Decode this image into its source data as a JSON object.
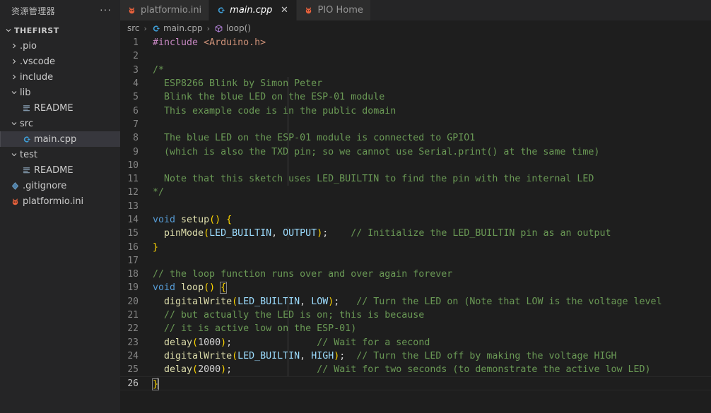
{
  "sidebar": {
    "title": "资源管理器",
    "more_label": "···",
    "root": {
      "label": "THEFIRST",
      "expanded": true
    },
    "items": [
      {
        "label": ".pio",
        "type": "folder",
        "expanded": false,
        "indent": 1,
        "icon": "chevron-right-icon"
      },
      {
        "label": ".vscode",
        "type": "folder",
        "expanded": false,
        "indent": 1,
        "icon": "chevron-right-icon"
      },
      {
        "label": "include",
        "type": "folder",
        "expanded": false,
        "indent": 1,
        "icon": "chevron-right-icon"
      },
      {
        "label": "lib",
        "type": "folder",
        "expanded": true,
        "indent": 1,
        "icon": "chevron-down-icon"
      },
      {
        "label": "README",
        "type": "file",
        "indent": 2,
        "icon": "readme-icon"
      },
      {
        "label": "src",
        "type": "folder",
        "expanded": true,
        "indent": 1,
        "icon": "chevron-down-icon"
      },
      {
        "label": "main.cpp",
        "type": "file",
        "indent": 2,
        "icon": "cpp-file-icon",
        "selected": true
      },
      {
        "label": "test",
        "type": "folder",
        "expanded": true,
        "indent": 1,
        "icon": "chevron-down-icon"
      },
      {
        "label": "README",
        "type": "file",
        "indent": 2,
        "icon": "readme-icon"
      },
      {
        "label": ".gitignore",
        "type": "file",
        "indent": 1,
        "icon": "git-icon"
      },
      {
        "label": "platformio.ini",
        "type": "file",
        "indent": 1,
        "icon": "platformio-icon"
      }
    ]
  },
  "tabs": [
    {
      "label": "platformio.ini",
      "icon": "platformio-icon",
      "active": false,
      "closable": false
    },
    {
      "label": "main.cpp",
      "icon": "cpp-file-icon",
      "active": true,
      "closable": true,
      "close_label": "✕"
    },
    {
      "label": "PIO Home",
      "icon": "platformio-icon",
      "active": false,
      "closable": false
    }
  ],
  "breadcrumb": {
    "separator": "›",
    "items": [
      {
        "label": "src",
        "icon": null
      },
      {
        "label": "main.cpp",
        "icon": "cpp-file-icon"
      },
      {
        "label": "loop()",
        "icon": "symbol-method-icon"
      }
    ]
  },
  "editor": {
    "language": "cpp",
    "active_line": 26,
    "total_lines": 26,
    "lines": [
      {
        "n": 1,
        "tokens": [
          {
            "t": "#include ",
            "c": "t-pp"
          },
          {
            "t": "<Arduino.h>",
            "c": "t-str"
          }
        ]
      },
      {
        "n": 2,
        "tokens": []
      },
      {
        "n": 3,
        "tokens": [
          {
            "t": "/*",
            "c": "t-cmt"
          }
        ]
      },
      {
        "n": 4,
        "tokens": [
          {
            "t": "  ESP8266 Blink by Simon Peter",
            "c": "t-cmt"
          }
        ]
      },
      {
        "n": 5,
        "tokens": [
          {
            "t": "  Blink the blue LED on the ESP-01 module",
            "c": "t-cmt"
          }
        ]
      },
      {
        "n": 6,
        "tokens": [
          {
            "t": "  This example code is in the public domain",
            "c": "t-cmt"
          }
        ]
      },
      {
        "n": 7,
        "tokens": []
      },
      {
        "n": 8,
        "tokens": [
          {
            "t": "  The blue LED on the ESP-01 module is connected to GPIO1",
            "c": "t-cmt"
          }
        ]
      },
      {
        "n": 9,
        "tokens": [
          {
            "t": "  (which is also the TXD pin; so we cannot use Serial.print() at the same time)",
            "c": "t-cmt"
          }
        ]
      },
      {
        "n": 10,
        "tokens": []
      },
      {
        "n": 11,
        "tokens": [
          {
            "t": "  Note that this sketch uses LED_BUILTIN to find the pin with the internal LED",
            "c": "t-cmt"
          }
        ]
      },
      {
        "n": 12,
        "tokens": [
          {
            "t": "*/",
            "c": "t-cmt"
          }
        ]
      },
      {
        "n": 13,
        "tokens": []
      },
      {
        "n": 14,
        "tokens": [
          {
            "t": "void",
            "c": "t-kw"
          },
          {
            "t": " ",
            "c": "t-punc"
          },
          {
            "t": "setup",
            "c": "t-fn"
          },
          {
            "t": "()",
            "c": "t-br1"
          },
          {
            "t": " ",
            "c": "t-punc"
          },
          {
            "t": "{",
            "c": "t-br1"
          }
        ]
      },
      {
        "n": 15,
        "tokens": [
          {
            "t": "  ",
            "c": "t-punc"
          },
          {
            "t": "pinMode",
            "c": "t-fn"
          },
          {
            "t": "(",
            "c": "t-br1"
          },
          {
            "t": "LED_BUILTIN",
            "c": "t-var"
          },
          {
            "t": ", ",
            "c": "t-punc"
          },
          {
            "t": "OUTPUT",
            "c": "t-var"
          },
          {
            "t": ")",
            "c": "t-br1"
          },
          {
            "t": ";",
            "c": "t-punc"
          },
          {
            "t": "    ",
            "c": "t-punc"
          },
          {
            "t": "// Initialize the LED_BUILTIN pin as an output",
            "c": "t-cmt"
          }
        ]
      },
      {
        "n": 16,
        "tokens": [
          {
            "t": "}",
            "c": "t-br1"
          }
        ]
      },
      {
        "n": 17,
        "tokens": []
      },
      {
        "n": 18,
        "tokens": [
          {
            "t": "// the loop function runs over and over again forever",
            "c": "t-cmt"
          }
        ]
      },
      {
        "n": 19,
        "tokens": [
          {
            "t": "void",
            "c": "t-kw"
          },
          {
            "t": " ",
            "c": "t-punc"
          },
          {
            "t": "loop",
            "c": "t-fn"
          },
          {
            "t": "()",
            "c": "t-br1"
          },
          {
            "t": " ",
            "c": "t-punc"
          },
          {
            "t": "{",
            "c": "t-br1 brmatch"
          }
        ]
      },
      {
        "n": 20,
        "tokens": [
          {
            "t": "  ",
            "c": "t-punc"
          },
          {
            "t": "digitalWrite",
            "c": "t-fn"
          },
          {
            "t": "(",
            "c": "t-br1"
          },
          {
            "t": "LED_BUILTIN",
            "c": "t-var"
          },
          {
            "t": ", ",
            "c": "t-punc"
          },
          {
            "t": "LOW",
            "c": "t-var"
          },
          {
            "t": ")",
            "c": "t-br1"
          },
          {
            "t": ";",
            "c": "t-punc"
          },
          {
            "t": "   ",
            "c": "t-punc"
          },
          {
            "t": "// Turn the LED on (Note that LOW is the voltage level",
            "c": "t-cmt"
          }
        ]
      },
      {
        "n": 21,
        "tokens": [
          {
            "t": "  // but actually the LED is on; this is because",
            "c": "t-cmt"
          }
        ]
      },
      {
        "n": 22,
        "tokens": [
          {
            "t": "  // it is active low on the ESP-01)",
            "c": "t-cmt"
          }
        ]
      },
      {
        "n": 23,
        "tokens": [
          {
            "t": "  ",
            "c": "t-punc"
          },
          {
            "t": "delay",
            "c": "t-fn"
          },
          {
            "t": "(",
            "c": "t-br1"
          },
          {
            "t": "1000",
            "c": "t-num"
          },
          {
            "t": ")",
            "c": "t-br1"
          },
          {
            "t": ";",
            "c": "t-punc"
          },
          {
            "t": "               ",
            "c": "t-punc"
          },
          {
            "t": "// Wait for a second",
            "c": "t-cmt"
          }
        ]
      },
      {
        "n": 24,
        "tokens": [
          {
            "t": "  ",
            "c": "t-punc"
          },
          {
            "t": "digitalWrite",
            "c": "t-fn"
          },
          {
            "t": "(",
            "c": "t-br1"
          },
          {
            "t": "LED_BUILTIN",
            "c": "t-var"
          },
          {
            "t": ", ",
            "c": "t-punc"
          },
          {
            "t": "HIGH",
            "c": "t-var"
          },
          {
            "t": ")",
            "c": "t-br1"
          },
          {
            "t": ";",
            "c": "t-punc"
          },
          {
            "t": "  ",
            "c": "t-punc"
          },
          {
            "t": "// Turn the LED off by making the voltage HIGH",
            "c": "t-cmt"
          }
        ]
      },
      {
        "n": 25,
        "tokens": [
          {
            "t": "  ",
            "c": "t-punc"
          },
          {
            "t": "delay",
            "c": "t-fn"
          },
          {
            "t": "(",
            "c": "t-br1"
          },
          {
            "t": "2000",
            "c": "t-num"
          },
          {
            "t": ")",
            "c": "t-br1"
          },
          {
            "t": ";",
            "c": "t-punc"
          },
          {
            "t": "               ",
            "c": "t-punc"
          },
          {
            "t": "// Wait for two seconds (to demonstrate the active low LED)",
            "c": "t-cmt"
          }
        ]
      },
      {
        "n": 26,
        "tokens": [
          {
            "t": "}",
            "c": "t-br1 brmatch"
          }
        ],
        "caret_after": true
      }
    ],
    "indent_guides": [
      {
        "from_line": 4,
        "to_line": 11
      },
      {
        "from_line": 15,
        "to_line": 15
      },
      {
        "from_line": 20,
        "to_line": 25
      }
    ]
  },
  "colors": {
    "editor_bg": "#1e1e1e",
    "sidebar_bg": "#252526",
    "tab_inactive_bg": "#2d2d2d",
    "tab_active_bg": "#1e1e1e",
    "selection_bg": "#37373d",
    "foreground": "#d4d4d4",
    "line_number": "#858585",
    "comment": "#6a9955",
    "keyword": "#569cd6",
    "function": "#dcdcaa",
    "variable": "#9cdcfe",
    "string": "#ce9178",
    "preprocessor": "#c586c0",
    "bracket": "#ffd700",
    "accent_orange": "#e8623d"
  }
}
